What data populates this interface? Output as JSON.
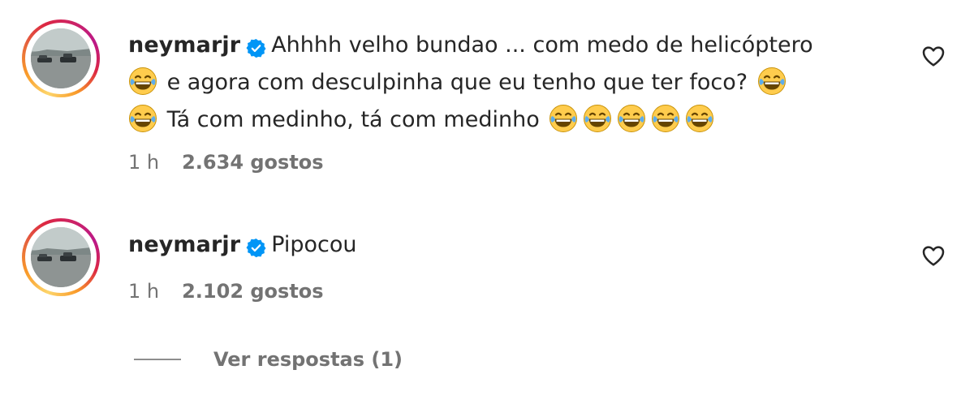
{
  "comments": [
    {
      "username": "neymarjr",
      "verified": true,
      "text_lines": [
        "Ahhhh velho bundao ... com medo de helicóptero",
        "e agora com desculpinha que eu tenho que ter foco?",
        "Tá com medinho, tá com medinho"
      ],
      "emojis": "face-with-tears-of-joy",
      "time": "1 h",
      "likes": "2.634 gostos"
    },
    {
      "username": "neymarjr",
      "verified": true,
      "text_lines": [
        "Pipocou"
      ],
      "time": "1 h",
      "likes": "2.102 gostos"
    }
  ],
  "replies": {
    "label": "Ver respostas (1)"
  },
  "colors": {
    "text": "#262626",
    "secondary": "#737373",
    "verified_blue": "#0095f6",
    "emoji_yellow": "#ffcc4d"
  }
}
